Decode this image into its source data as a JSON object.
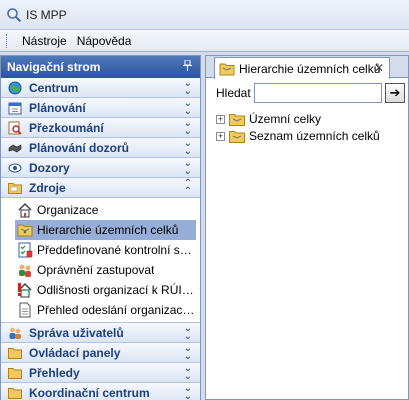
{
  "window": {
    "title": "IS MPP"
  },
  "menu": {
    "items": [
      "Nástroje",
      "Nápověda"
    ]
  },
  "nav": {
    "header": "Navigační strom",
    "sections_top": [
      {
        "label": "Centrum",
        "icon": "globe-icon"
      },
      {
        "label": "Plánování",
        "icon": "calendar-icon"
      },
      {
        "label": "Přezkoumání",
        "icon": "magnifier-icon"
      },
      {
        "label": "Plánování dozorů",
        "icon": "handshake-icon"
      },
      {
        "label": "Dozory",
        "icon": "eye-icon"
      }
    ],
    "expanded_section": {
      "label": "Zdroje",
      "icon": "folder-icon"
    },
    "subitems": [
      {
        "label": "Organizace",
        "icon": "house-icon",
        "selected": false
      },
      {
        "label": "Hierarchie územních celků",
        "icon": "folder-hierarchy-icon",
        "selected": true
      },
      {
        "label": "Předdefinované kontrolní s…",
        "icon": "checklist-icon",
        "selected": false
      },
      {
        "label": "Oprávnění zastupovat",
        "icon": "people-icon",
        "selected": false
      },
      {
        "label": "Odlišnosti organizací k RÚIAN",
        "icon": "warning-house-icon",
        "selected": false
      },
      {
        "label": "Přehled odeslání organizací …",
        "icon": "document-icon",
        "selected": false
      }
    ],
    "sections_bottom": [
      {
        "label": "Správa uživatelů",
        "icon": "users-icon"
      },
      {
        "label": "Ovládací panely",
        "icon": "folder-icon"
      },
      {
        "label": "Přehledy",
        "icon": "folder-icon"
      },
      {
        "label": "Koordinační centrum",
        "icon": "folder-icon"
      }
    ]
  },
  "right": {
    "tab_label": "Hierarchie územních celků",
    "search_label": "Hledat",
    "search_value": "",
    "search_button": "➔",
    "tree": [
      "Územní celky",
      "Seznam územních celků"
    ]
  }
}
